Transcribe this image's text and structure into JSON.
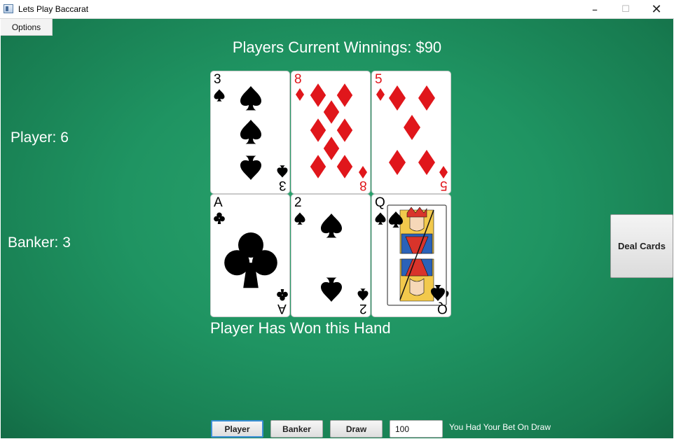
{
  "window": {
    "title": "Lets Play Baccarat"
  },
  "menu": {
    "options_label": "Options"
  },
  "table": {
    "winnings": "Players Current Winnings: $90",
    "player_score": "Player: 6",
    "banker_score": "Banker: 3",
    "result": "Player Has Won this Hand"
  },
  "cards": {
    "player": [
      {
        "rank": "3",
        "suit": "spades",
        "suit_symbol": "♠",
        "color": "black"
      },
      {
        "rank": "8",
        "suit": "diamonds",
        "suit_symbol": "♦",
        "color": "red"
      },
      {
        "rank": "5",
        "suit": "diamonds",
        "suit_symbol": "♦",
        "color": "red"
      }
    ],
    "banker": [
      {
        "rank": "A",
        "suit": "clubs",
        "suit_symbol": "♣",
        "color": "black"
      },
      {
        "rank": "2",
        "suit": "spades",
        "suit_symbol": "♠",
        "color": "black"
      },
      {
        "rank": "Q",
        "suit": "spades",
        "suit_symbol": "♠",
        "color": "black"
      }
    ]
  },
  "controls": {
    "deal_label": "Deal Cards",
    "player_label": "Player",
    "banker_label": "Banker",
    "draw_label": "Draw",
    "bet_value": "100",
    "bet_status": "You Had Your Bet On Draw"
  },
  "colors": {
    "felt": "#1f9462",
    "suit_red": "#e0161b",
    "suit_black": "#000000",
    "focus_blue": "#3b8fd6"
  }
}
